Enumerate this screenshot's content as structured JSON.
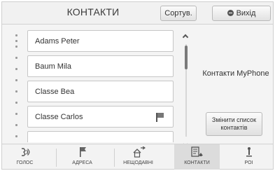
{
  "header": {
    "title": "КОНТАКТИ",
    "sort_label": "Сортув.",
    "exit_label": "Вихід",
    "exit_icon": "exit-icon"
  },
  "contacts": [
    {
      "name": "Adams Peter",
      "has_flag": false
    },
    {
      "name": "Baum Mila",
      "has_flag": false
    },
    {
      "name": "Classe Bea",
      "has_flag": false
    },
    {
      "name": "Classe Carlos",
      "has_flag": true
    }
  ],
  "panel": {
    "source_label": "Контакти MyPhone",
    "change_list_label": "Змінити список контактів"
  },
  "nav": [
    {
      "label": "ГОЛОС",
      "icon": "voice-icon",
      "active": false
    },
    {
      "label": "АДРЕСА",
      "icon": "address-flag-icon",
      "active": false
    },
    {
      "label": "НЕЩОДАВНІ",
      "icon": "recent-icon",
      "active": false
    },
    {
      "label": "КОНТАКТИ",
      "icon": "contacts-icon",
      "active": true
    },
    {
      "label": "POI",
      "icon": "poi-icon",
      "active": false
    }
  ],
  "colors": {
    "background": "#f4f4f4",
    "active_tab": "#dcdcdc",
    "item_bg": "#ffffff"
  }
}
